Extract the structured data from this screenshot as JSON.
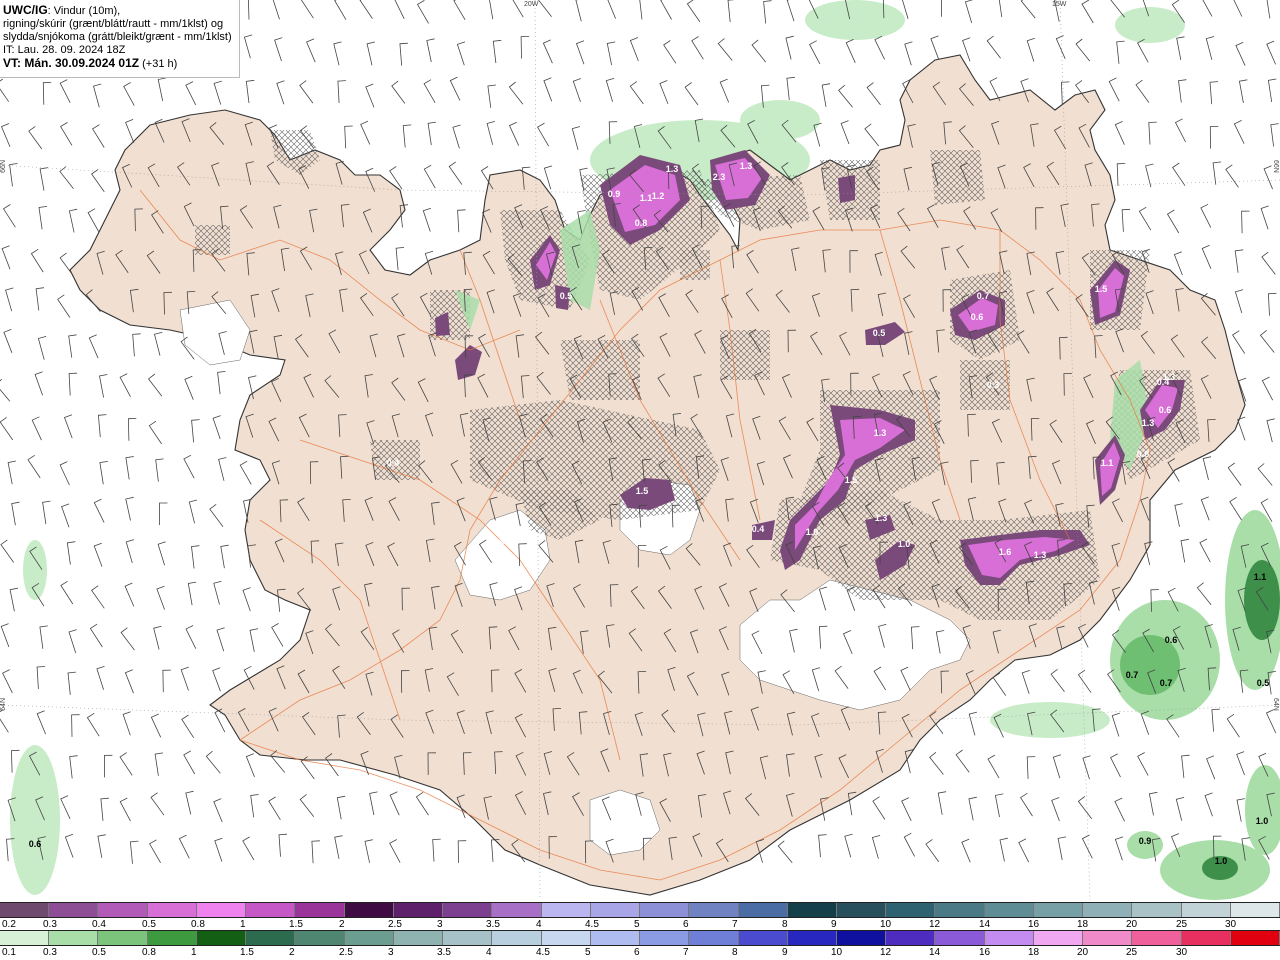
{
  "header": {
    "source": "UWC/IG",
    "description_line1": ": Vindur (10m),",
    "description_line2": "rigning/skúrir (grænt/blátt/rautt - mm/1klst) og",
    "description_line3": "slydda/snjókoma (grátt/bleikt/grænt - mm/1klst)",
    "issue_time": "IT: Lau. 28. 09. 2024 18Z",
    "valid_label": "VT: Mán. 30.09.2024 01Z",
    "lead_time": " (+31 h)"
  },
  "graticule": {
    "lon_20": "20W",
    "lon_15": "15W",
    "lat_66": "66N",
    "lat_64": "64N"
  },
  "snow_labels": [
    "1.3",
    "1.2",
    "1.1",
    "0.8",
    "0.9",
    "2.3",
    "1.3",
    "0.7",
    "1.3",
    "0.6",
    "1.5",
    "1.3",
    "0.6",
    "0.4",
    "1.3",
    "1.1",
    "0.8",
    "1.6",
    "1.3",
    "1.0",
    "1.5",
    "1.5",
    "1.0",
    "1.3",
    "0.4",
    "0.5",
    "0.3",
    "0.4",
    "0.5",
    "0.3"
  ],
  "rain_labels": [
    "0.6",
    "0.7",
    "0.7",
    "0.5",
    "1.1",
    "1.0",
    "0.9",
    "1.0",
    "0.6"
  ],
  "legend_snow": {
    "ticks": [
      "0.2",
      "0.3",
      "0.4",
      "0.5",
      "0.8",
      "1",
      "1.5",
      "2",
      "2.5",
      "3",
      "3.5",
      "4",
      "4.5",
      "5",
      "6",
      "7",
      "8",
      "9",
      "10",
      "12",
      "14",
      "16",
      "18",
      "20",
      "25",
      "30"
    ],
    "colors": [
      "#6e4a6e",
      "#8e4e96",
      "#b25ab8",
      "#d76fd6",
      "#ef82ef",
      "#c657c6",
      "#9a339a",
      "#3e0b43",
      "#5e1f6b",
      "#7d3f90",
      "#a76fc6",
      "#bbb6f0",
      "#a9a6e8",
      "#8d8fd7",
      "#7082c2",
      "#4a6da5",
      "#143f4a",
      "#274f5c",
      "#2f6270",
      "#4a7a85",
      "#5f8d96",
      "#779fa6",
      "#8fb0b6",
      "#a8c2c6",
      "#c1d3d6",
      "#dde6e8"
    ]
  },
  "legend_rain": {
    "ticks": [
      "0.1",
      "0.3",
      "0.5",
      "0.8",
      "1",
      "1.5",
      "2",
      "2.5",
      "3",
      "3.5",
      "4",
      "4.5",
      "5",
      "6",
      "7",
      "8",
      "9",
      "10",
      "12",
      "14",
      "16",
      "18",
      "20",
      "25",
      "30"
    ],
    "colors": [
      "#d6f1d6",
      "#a9dea9",
      "#7cc47c",
      "#3e9a3e",
      "#135f13",
      "#2c6b4e",
      "#4e8671",
      "#6c9d91",
      "#8fb3b1",
      "#a6c2c8",
      "#b8cfe0",
      "#c7d7f0",
      "#aebcf0",
      "#8b9be4",
      "#6f7fd8",
      "#4b4bd0",
      "#2828c0",
      "#1010a0",
      "#4e2cc0",
      "#8a5ad8",
      "#c48cf0",
      "#f0a8f0",
      "#f08ac8",
      "#f0609a",
      "#e83060",
      "#e00010"
    ]
  },
  "colors": {
    "land": "#f1dfd1",
    "sea": "#ffffff",
    "glacier": "#ffffff",
    "roads": "#e8763a",
    "coast": "#333333",
    "rain_light": "#c8ecc8",
    "rain_mid": "#8fd08f",
    "rain_dark": "#3d8f4a",
    "snow_light": "#7a4a7a",
    "snow_mid": "#c060c0",
    "snow_bright": "#ee8aee"
  }
}
